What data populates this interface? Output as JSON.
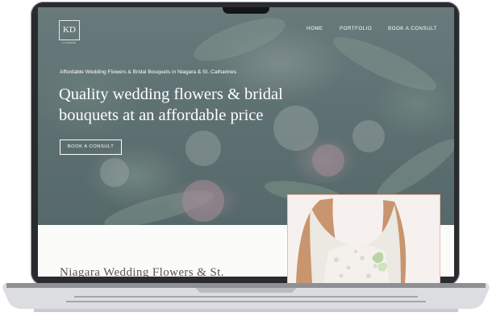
{
  "nav": {
    "logo_text": "KD",
    "logo_subtext": "FLOWERS",
    "links": [
      "HOME",
      "PORTFOLIO",
      "BOOK A CONSULT"
    ]
  },
  "hero": {
    "kicker": "Affordable Wedding Flowers & Bridal Bouquets in Niagara & St. Catharines",
    "headline_line1": "Quality wedding flowers & bridal",
    "headline_line2": "bouquets at an affordable price",
    "cta_label": "BOOK A CONSULT"
  },
  "section": {
    "title": "Niagara Wedding Flowers & St."
  },
  "colors": {
    "overlay": "#5f7374",
    "accent_border": "#efb9a6",
    "section_text": "#5d5254"
  }
}
